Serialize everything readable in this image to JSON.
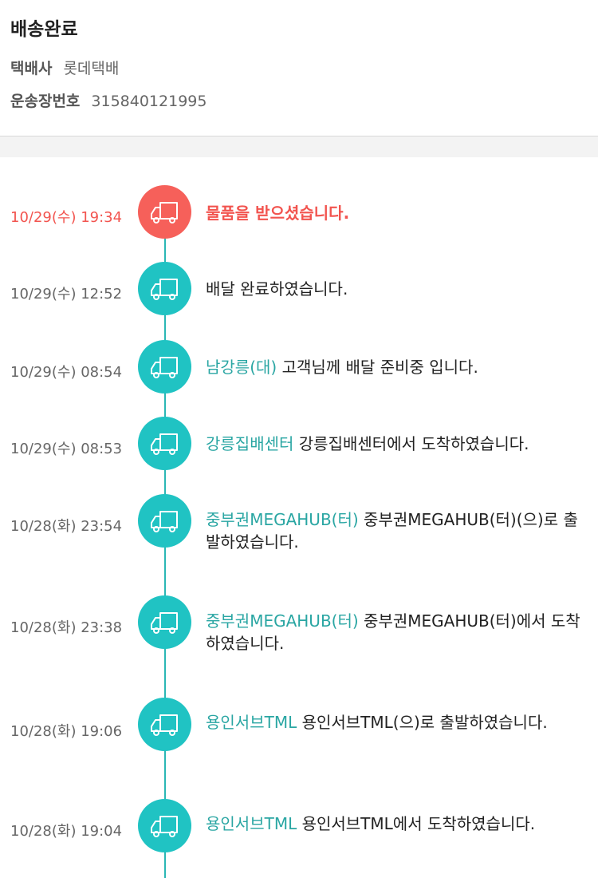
{
  "header": {
    "status_title": "배송완료",
    "courier_label": "택배사",
    "courier_value": "롯데택배",
    "tracking_label": "운송장번호",
    "tracking_value": "315840121995"
  },
  "colors": {
    "accent_teal": "#20c3c3",
    "active_red": "#f6605a",
    "location_text": "#2aa6a3"
  },
  "icon": "delivery-truck-icon",
  "events": [
    {
      "time": "10/29(수) 19:34",
      "location": "",
      "message": "물품을 받으셨습니다."
    },
    {
      "time": "10/29(수) 12:52",
      "location": "",
      "message": "배달 완료하였습니다."
    },
    {
      "time": "10/29(수) 08:54",
      "location": "남강릉(대)",
      "message": "고객님께 배달 준비중 입니다."
    },
    {
      "time": "10/29(수) 08:53",
      "location": "강릉집배센터",
      "message": "강릉집배센터에서 도착하였습니다."
    },
    {
      "time": "10/28(화) 23:54",
      "location": "중부권MEGAHUB(터)",
      "message": "중부권MEGAHUB(터)(으)로 출발하였습니다."
    },
    {
      "time": "10/28(화) 23:38",
      "location": "중부권MEGAHUB(터)",
      "message": "중부권MEGAHUB(터)에서 도착하였습니다."
    },
    {
      "time": "10/28(화) 19:06",
      "location": "용인서브TML",
      "message": "용인서브TML(으)로 출발하였습니다."
    },
    {
      "time": "10/28(화) 19:04",
      "location": "용인서브TML",
      "message": "용인서브TML에서 도착하였습니다."
    }
  ]
}
